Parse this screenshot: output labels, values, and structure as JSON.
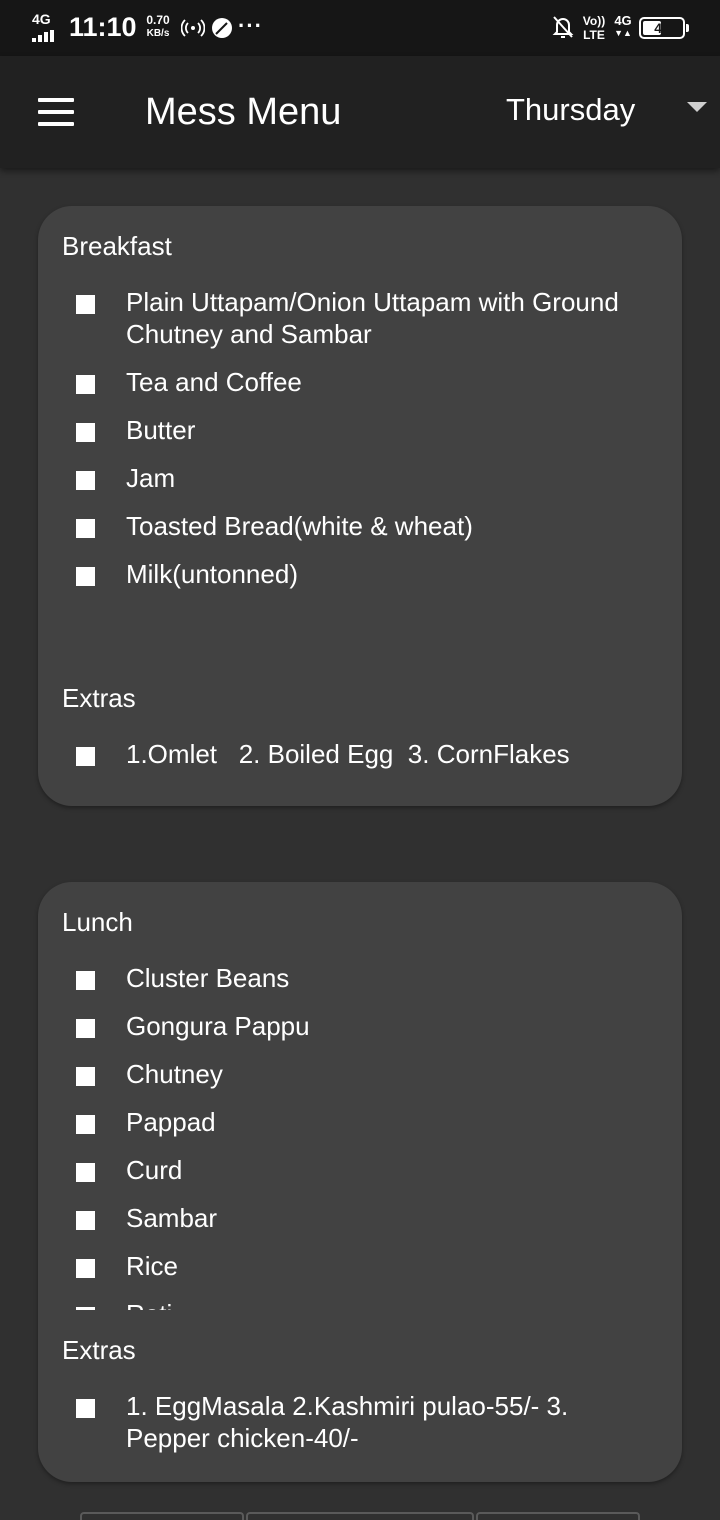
{
  "status_bar": {
    "network": "4G",
    "time": "11:10",
    "speed_value": "0.70",
    "speed_unit": "KB/s",
    "more": "···",
    "volte_top": "Vo))",
    "volte_bottom": "LTE",
    "network_right": "4G",
    "battery_level": "47",
    "battery_fraction": 0.47,
    "icons": [
      "signal-icon",
      "hotspot-icon",
      "leaf-icon",
      "muted-bell-icon",
      "battery-icon"
    ]
  },
  "app_bar": {
    "title": "Mess Menu",
    "day": "Thursday",
    "icons": [
      "menu-icon",
      "dropdown-caret-icon"
    ]
  },
  "breakfast": {
    "title": "Breakfast",
    "items": [
      "Plain Uttapam/Onion Uttapam with Ground Chutney and Sambar",
      "Tea and Coffee",
      "Butter",
      "Jam",
      "Toasted Bread(white & wheat)",
      "Milk(untonned)"
    ],
    "extras_title": "Extras",
    "extras": [
      "1.Omlet   2. Boiled Egg  3. CornFlakes"
    ]
  },
  "lunch": {
    "title": "Lunch",
    "items": [
      "Cluster Beans",
      "Gongura Pappu",
      "Chutney",
      "Pappad",
      "Curd",
      "Sambar",
      "Rice",
      "Roti"
    ],
    "extras_title": "Extras",
    "extras": [
      "1. EggMasala 2.Kashmiri pulao-55/- 3. Pepper chicken-40/-"
    ]
  },
  "colors": {
    "background": "#303030",
    "app_bar": "#212121",
    "status_bar": "#161616",
    "card": "#424242",
    "text": "#ffffff"
  }
}
